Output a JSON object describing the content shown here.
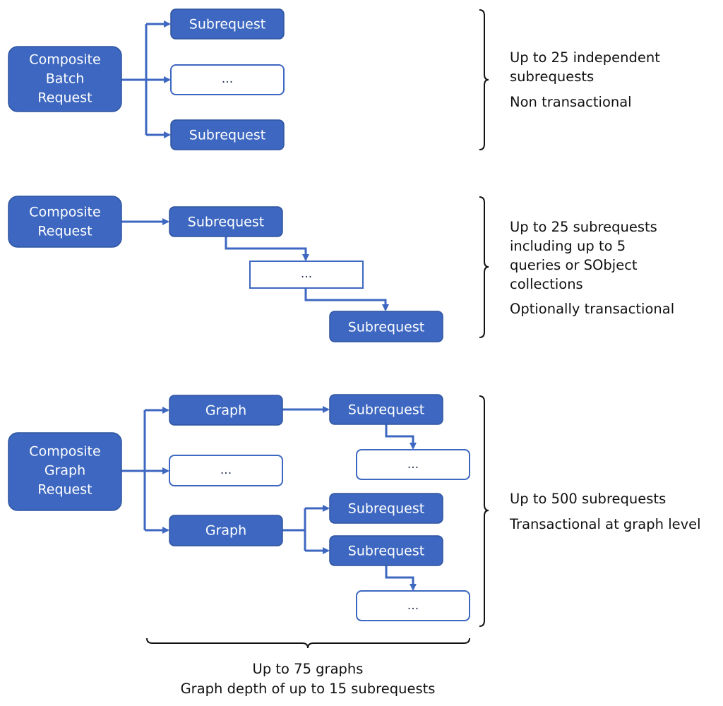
{
  "colors": {
    "box_fill": "#3d67c0",
    "connector": "#3d67c0",
    "text": "#111111"
  },
  "batch": {
    "root": [
      "Composite",
      "Batch",
      "Request"
    ],
    "sub1": "Subrequest",
    "ellipsis": "...",
    "sub2": "Subrequest",
    "notes": [
      "Up to 25 independent",
      "subrequests",
      "Non transactional"
    ]
  },
  "composite": {
    "root": [
      "Composite",
      "Request"
    ],
    "sub1": "Subrequest",
    "ellipsis": "...",
    "sub2": "Subrequest",
    "notes": [
      "Up to 25 subrequests",
      "including up to 5",
      "queries or SObject",
      "collections",
      "Optionally transactional"
    ]
  },
  "graph": {
    "root": [
      "Composite",
      "Graph",
      "Request"
    ],
    "graph1": "Graph",
    "ellipsis": "...",
    "graph2": "Graph",
    "g1_sub": "Subrequest",
    "g1_ellipsis": "...",
    "g2_sub1": "Subrequest",
    "g2_sub2": "Subrequest",
    "g2_ellipsis": "...",
    "notes": [
      "Up to 500 subrequests",
      "Transactional at graph level"
    ],
    "bottom_notes": [
      "Up to 75 graphs",
      "Graph depth of up to 15 subrequests"
    ]
  }
}
